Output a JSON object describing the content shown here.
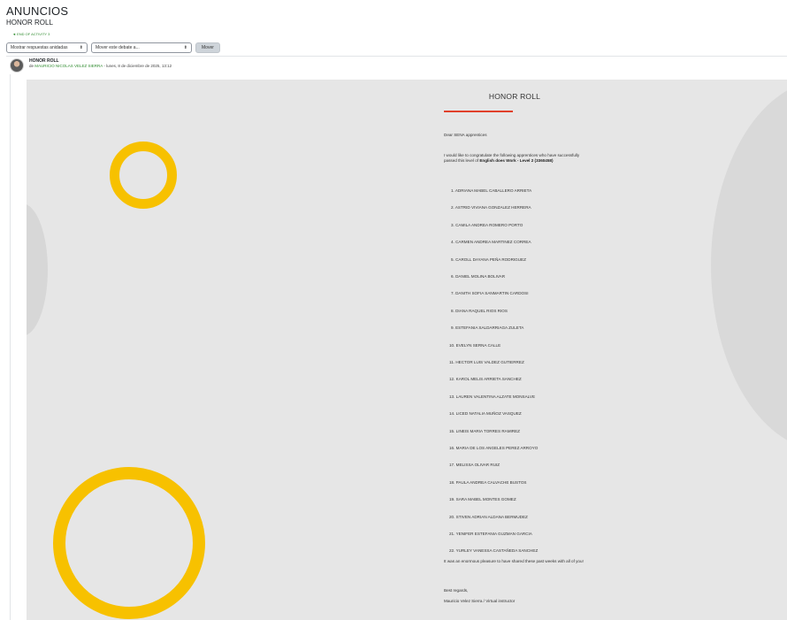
{
  "page": {
    "heading": "ANUNCIOS",
    "subheading": "HONOR ROLL",
    "back_link": "◄ END OF ACTIVITY 3"
  },
  "controls": {
    "reply_select": "Mostrar respuestas anidadas",
    "move_select": "Mover este debate a...",
    "move_button": "Mover"
  },
  "post": {
    "title": "HONOR ROLL",
    "by_prefix": "de",
    "author": "MAURICIO NICOLAS VELEZ SIERRA",
    "date": "- lunes, 8 de diciembre de 2025, 13:12"
  },
  "letter": {
    "title": "HONOR ROLL",
    "greeting": "Dear SENA apprentices",
    "intro_text": "I would like to congratulate the following apprentices who have successfully passed this level of",
    "intro_bold": "English does Work - Level 2 (3360458)",
    "names": [
      "1. ADRIANA MABEL CABALLERO ARRIETA",
      "2. ASTRID VIVIANA GONZALEZ HERRERA",
      "3. CAMILA ANDREA ROMERO PORTO",
      "4. CARMEN ANDREA MARTINEZ CORREA",
      "5. CAROLL DAYANA PEÑA RODRIGUEZ",
      "6. DANIEL MOLINA BOLIVAR",
      "7. DANITH SOFIA SANMARTIN CARDOSI",
      "8. DIANA RAQUEL RIOS RIOS",
      "9. ESTEFANIA SALDARRIAGA ZULETA",
      "10. EVELYN SERNA CALLE",
      "11. HECTOR LUIS VALDEZ GUTIERREZ",
      "12. KAROL MELIS ARRIETA SANCHEZ",
      "13. LAUREN VALENTINA ALZATE MONSALVE",
      "14. LICED NATALIA MUÑOZ VASQUEZ",
      "15. LINEIS MARIA TORRES RAMIREZ",
      "16. MARIA DE LOS ANGELES PEREZ ARROYO",
      "17. MELISSA OLIVAR RUIZ",
      "18. PAULA ANDREA CALVACHE BUSTOS",
      "19. SARA MABEL MONTES GOMEZ",
      "20. STIVEN ADRIAN ALDANA BERMUDEZ",
      "21. YENIFER ESTEFANIA GUZMAN GARCIA",
      "22. YURLEY VANESSA CASTAÑEDA SANCHEZ"
    ],
    "closing": "It was an enormous pleasure to have shared these past weeks with all of you!",
    "regards": "Best regards,",
    "signature": "Mauricio Velez Sierra / Virtual instructor"
  },
  "colors": {
    "accent_yellow": "#f7c100",
    "accent_red": "#e0402a",
    "link_green": "#2e8b2e",
    "banner_bg": "#e6e6e6"
  }
}
